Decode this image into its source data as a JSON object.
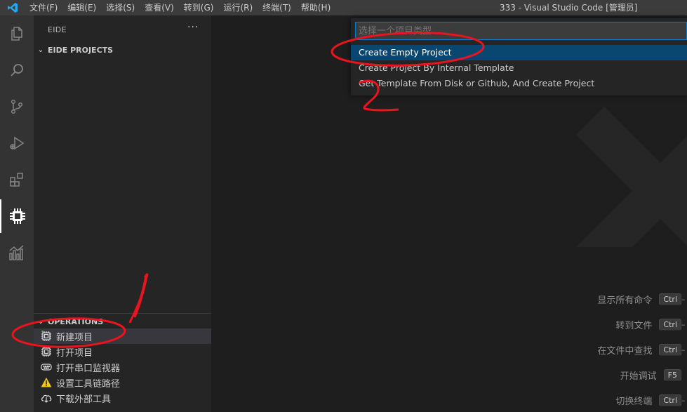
{
  "window": {
    "title": "333 - Visual Studio Code [管理员]"
  },
  "menu": {
    "items": [
      "文件(F)",
      "编辑(E)",
      "选择(S)",
      "查看(V)",
      "转到(G)",
      "运行(R)",
      "终端(T)",
      "帮助(H)"
    ]
  },
  "activity_bar": {
    "items": [
      "explorer-icon",
      "search-icon",
      "source-control-icon",
      "run-debug-icon",
      "extensions-icon",
      "eide-chip-icon",
      "chart-icon"
    ],
    "active": "eide-chip-icon"
  },
  "sidebar": {
    "title": "EIDE",
    "more": "···",
    "projects_header": "EIDE PROJECTS",
    "operations_header": "OPERATIONS",
    "operations": [
      {
        "label": "新建项目",
        "icon": "new-project-icon"
      },
      {
        "label": "打开项目",
        "icon": "open-project-icon"
      },
      {
        "label": "打开串口监视器",
        "icon": "serial-monitor-icon"
      },
      {
        "label": "设置工具链路径",
        "icon": "warning-icon"
      },
      {
        "label": "下载外部工具",
        "icon": "download-tools-icon"
      }
    ]
  },
  "quick_pick": {
    "placeholder": "选择一个项目类型",
    "items": [
      "Create Empty Project",
      "Create Project By Internal Template",
      "Get Template From Disk or Github, And Create Project"
    ],
    "focused_index": 0
  },
  "shortcuts": [
    {
      "label": "显示所有命令",
      "key": "Ctrl"
    },
    {
      "label": "转到文件",
      "key": "Ctrl"
    },
    {
      "label": "在文件中查找",
      "key": "Ctrl"
    },
    {
      "label": "开始调试",
      "key": "F5"
    },
    {
      "label": "切换终端",
      "key": "Ctrl"
    }
  ],
  "colors": {
    "title_bar": "#3c3c3c",
    "activity_bar": "#333333",
    "sidebar": "#252526",
    "editor": "#1e1e1e",
    "focus_border": "#007fd4",
    "selection": "#094771",
    "annotation_red": "#e8141e"
  }
}
